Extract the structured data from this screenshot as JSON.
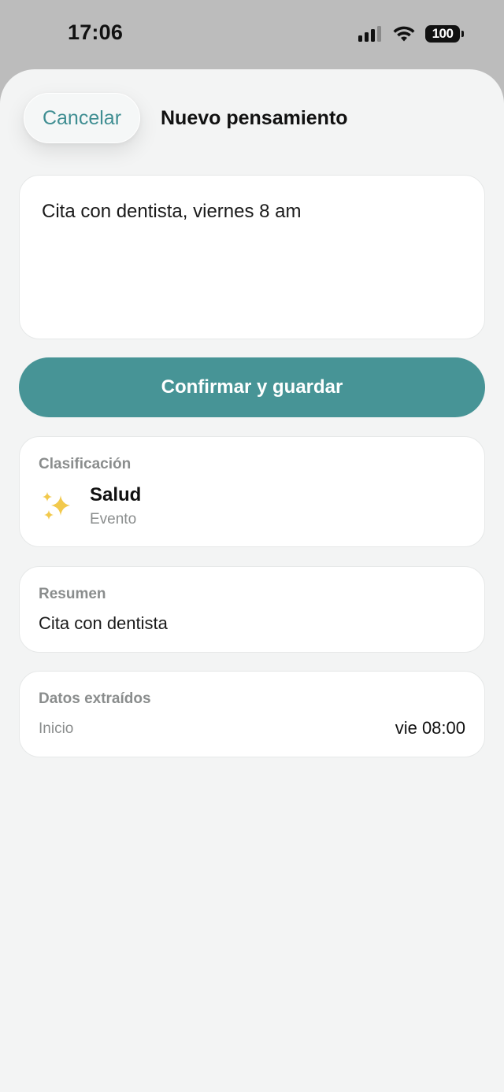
{
  "status_bar": {
    "time": "17:06",
    "battery": "100"
  },
  "sheet": {
    "cancel_label": "Cancelar",
    "title": "Nuevo pensamiento"
  },
  "thought": {
    "text": "Cita con dentista, viernes 8 am"
  },
  "confirm_label": "Confirmar y guardar",
  "classification": {
    "label": "Clasificación",
    "icon": "sparkles-icon",
    "category": "Salud",
    "type": "Evento"
  },
  "summary": {
    "label": "Resumen",
    "text": "Cita con dentista"
  },
  "extracted": {
    "label": "Datos extraídos",
    "fields": [
      {
        "key": "Inicio",
        "value": "vie 08:00"
      }
    ]
  },
  "colors": {
    "accent": "#479496",
    "accent_text": "#3f8e92",
    "sheet_bg": "#f3f4f4",
    "status_bg": "#bcbcbc",
    "sparkle": "#f2c94c"
  }
}
